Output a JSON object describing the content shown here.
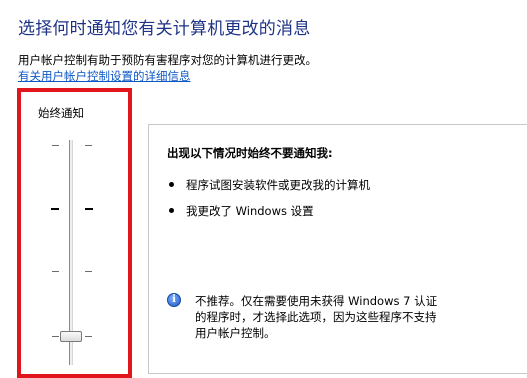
{
  "header": {
    "title": "选择何时通知您有关计算机更改的消息",
    "description": "用户帐户控制有助于预防有害程序对您的计算机进行更改。",
    "details_link": "有关用户帐户控制设置的详细信息"
  },
  "slider": {
    "top_label": "始终通知",
    "level": 0,
    "levels": 4
  },
  "info_panel": {
    "heading": "出现以下情况时始终不要通知我:",
    "bullets": [
      "程序试图安装软件或更改我的计算机",
      "我更改了 Windows 设置"
    ],
    "note_icon": "info-icon",
    "note_lines": [
      "不推荐。仅在需要使用未获得 Windows 7 认证",
      "的程序时，才选择此选项，因为这些程序不支持",
      "用户帐户控制。"
    ]
  },
  "colors": {
    "title": "#1e3287",
    "link": "#0b57c6",
    "highlight": "#e0161c"
  }
}
